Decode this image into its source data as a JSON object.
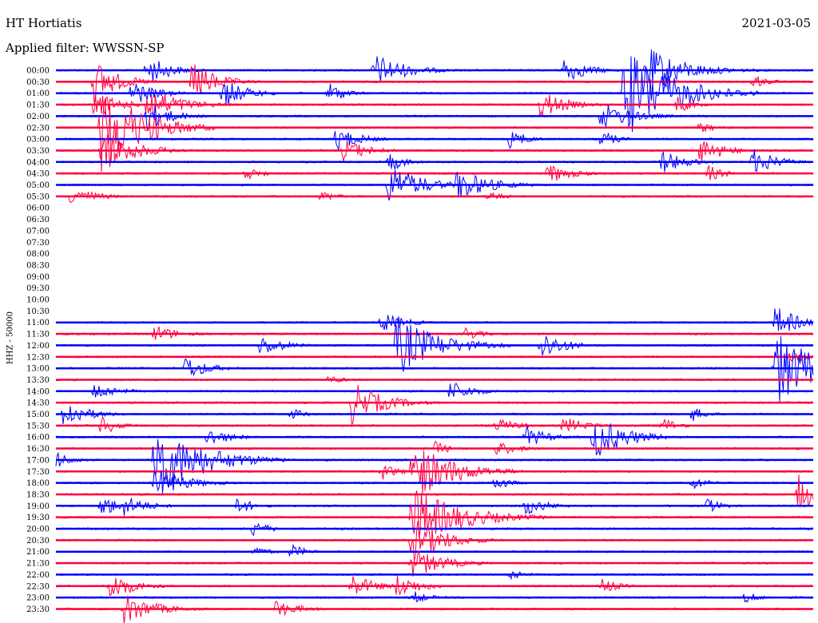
{
  "header": {
    "station": "HT Hortiatis",
    "date": "2021-03-05",
    "filter_label": "Applied filter:",
    "filter_value": "WWSSN-SP"
  },
  "colors": {
    "blue": "#0000ff",
    "red": "#ff0040"
  },
  "chart_data": {
    "type": "line",
    "title": "HT Hortiatis",
    "ylabel": "HHZ - 50000",
    "series_colors": [
      "blue",
      "red"
    ],
    "rows": [
      {
        "label": "00:00",
        "color": "blue",
        "events": [
          {
            "x": 0.12,
            "a": 20,
            "d": 0.03
          },
          {
            "x": 0.42,
            "a": 22,
            "d": 0.04
          },
          {
            "x": 0.67,
            "a": 18,
            "d": 0.03
          },
          {
            "x": 0.78,
            "a": 30,
            "d": 0.05
          }
        ]
      },
      {
        "label": "00:30",
        "color": "red",
        "events": [
          {
            "x": 0.05,
            "a": 30,
            "d": 0.03
          },
          {
            "x": 0.18,
            "a": 28,
            "d": 0.03
          },
          {
            "x": 0.92,
            "a": 10,
            "d": 0.02
          }
        ]
      },
      {
        "label": "01:00",
        "color": "blue",
        "events": [
          {
            "x": 0.1,
            "a": 18,
            "d": 0.03
          },
          {
            "x": 0.22,
            "a": 20,
            "d": 0.03
          },
          {
            "x": 0.36,
            "a": 16,
            "d": 0.02
          },
          {
            "x": 0.75,
            "a": 60,
            "d": 0.06
          }
        ]
      },
      {
        "label": "01:30",
        "color": "red",
        "events": [
          {
            "x": 0.05,
            "a": 20,
            "d": 0.03
          },
          {
            "x": 0.12,
            "a": 25,
            "d": 0.04
          },
          {
            "x": 0.64,
            "a": 20,
            "d": 0.03
          },
          {
            "x": 0.82,
            "a": 12,
            "d": 0.02
          }
        ]
      },
      {
        "label": "02:00",
        "color": "blue",
        "events": [
          {
            "x": 0.12,
            "a": 20,
            "d": 0.03
          },
          {
            "x": 0.72,
            "a": 18,
            "d": 0.04
          }
        ]
      },
      {
        "label": "02:30",
        "color": "red",
        "events": [
          {
            "x": 0.06,
            "a": 60,
            "d": 0.05
          },
          {
            "x": 0.85,
            "a": 8,
            "d": 0.02
          }
        ]
      },
      {
        "label": "03:00",
        "color": "blue",
        "events": [
          {
            "x": 0.37,
            "a": 16,
            "d": 0.03
          },
          {
            "x": 0.6,
            "a": 14,
            "d": 0.02
          },
          {
            "x": 0.72,
            "a": 12,
            "d": 0.02
          }
        ]
      },
      {
        "label": "03:30",
        "color": "red",
        "events": [
          {
            "x": 0.06,
            "a": 30,
            "d": 0.04
          },
          {
            "x": 0.38,
            "a": 16,
            "d": 0.03
          },
          {
            "x": 0.85,
            "a": 18,
            "d": 0.03
          }
        ]
      },
      {
        "label": "04:00",
        "color": "blue",
        "events": [
          {
            "x": 0.44,
            "a": 14,
            "d": 0.02
          },
          {
            "x": 0.8,
            "a": 16,
            "d": 0.03
          },
          {
            "x": 0.92,
            "a": 18,
            "d": 0.03
          }
        ]
      },
      {
        "label": "04:30",
        "color": "red",
        "events": [
          {
            "x": 0.25,
            "a": 10,
            "d": 0.02
          },
          {
            "x": 0.65,
            "a": 14,
            "d": 0.03
          },
          {
            "x": 0.86,
            "a": 12,
            "d": 0.02
          }
        ]
      },
      {
        "label": "05:00",
        "color": "blue",
        "events": [
          {
            "x": 0.44,
            "a": 28,
            "d": 0.04
          },
          {
            "x": 0.53,
            "a": 22,
            "d": 0.04
          }
        ]
      },
      {
        "label": "05:30",
        "color": "red",
        "events": [
          {
            "x": 0.02,
            "a": 14,
            "d": 0.03
          },
          {
            "x": 0.35,
            "a": 8,
            "d": 0.02
          },
          {
            "x": 0.57,
            "a": 8,
            "d": 0.02
          }
        ]
      },
      {
        "label": "06:00",
        "color": "blue",
        "events": []
      },
      {
        "label": "06:30",
        "color": "red",
        "events": []
      },
      {
        "label": "07:00",
        "color": "blue",
        "events": []
      },
      {
        "label": "07:30",
        "color": "red",
        "events": []
      },
      {
        "label": "08:00",
        "color": "blue",
        "events": []
      },
      {
        "label": "08:30",
        "color": "red",
        "events": []
      },
      {
        "label": "09:00",
        "color": "blue",
        "events": []
      },
      {
        "label": "09:30",
        "color": "red",
        "events": []
      },
      {
        "label": "10:00",
        "color": "blue",
        "events": []
      },
      {
        "label": "10:30",
        "color": "red",
        "events": []
      },
      {
        "label": "11:00",
        "color": "blue",
        "events": [
          {
            "x": 0.43,
            "a": 14,
            "d": 0.03
          },
          {
            "x": 0.95,
            "a": 22,
            "d": 0.03
          }
        ]
      },
      {
        "label": "11:30",
        "color": "red",
        "events": [
          {
            "x": 0.13,
            "a": 12,
            "d": 0.03
          },
          {
            "x": 0.54,
            "a": 10,
            "d": 0.02
          }
        ]
      },
      {
        "label": "12:00",
        "color": "blue",
        "events": [
          {
            "x": 0.27,
            "a": 14,
            "d": 0.03
          },
          {
            "x": 0.45,
            "a": 40,
            "d": 0.05
          },
          {
            "x": 0.64,
            "a": 20,
            "d": 0.03
          }
        ]
      },
      {
        "label": "12:30",
        "color": "red",
        "events": [
          {
            "x": 0.97,
            "a": 10,
            "d": 0.02
          }
        ]
      },
      {
        "label": "13:00",
        "color": "blue",
        "events": [
          {
            "x": 0.17,
            "a": 16,
            "d": 0.03
          },
          {
            "x": 0.95,
            "a": 50,
            "d": 0.05
          }
        ]
      },
      {
        "label": "13:30",
        "color": "red",
        "events": [
          {
            "x": 0.36,
            "a": 6,
            "d": 0.02
          }
        ]
      },
      {
        "label": "14:00",
        "color": "blue",
        "events": [
          {
            "x": 0.05,
            "a": 12,
            "d": 0.03
          },
          {
            "x": 0.52,
            "a": 14,
            "d": 0.03
          }
        ]
      },
      {
        "label": "14:30",
        "color": "red",
        "events": [
          {
            "x": 0.39,
            "a": 28,
            "d": 0.04
          }
        ]
      },
      {
        "label": "15:00",
        "color": "blue",
        "events": [
          {
            "x": 0.01,
            "a": 20,
            "d": 0.03
          },
          {
            "x": 0.31,
            "a": 8,
            "d": 0.02
          },
          {
            "x": 0.84,
            "a": 10,
            "d": 0.02
          }
        ]
      },
      {
        "label": "15:30",
        "color": "red",
        "events": [
          {
            "x": 0.06,
            "a": 14,
            "d": 0.02
          },
          {
            "x": 0.58,
            "a": 10,
            "d": 0.03
          },
          {
            "x": 0.67,
            "a": 12,
            "d": 0.03
          },
          {
            "x": 0.8,
            "a": 12,
            "d": 0.02
          }
        ]
      },
      {
        "label": "16:00",
        "color": "blue",
        "events": [
          {
            "x": 0.2,
            "a": 12,
            "d": 0.03
          },
          {
            "x": 0.62,
            "a": 14,
            "d": 0.03
          },
          {
            "x": 0.71,
            "a": 30,
            "d": 0.04
          }
        ]
      },
      {
        "label": "16:30",
        "color": "red",
        "events": [
          {
            "x": 0.5,
            "a": 10,
            "d": 0.02
          },
          {
            "x": 0.58,
            "a": 10,
            "d": 0.03
          }
        ]
      },
      {
        "label": "17:00",
        "color": "blue",
        "events": [
          {
            "x": 0.0,
            "a": 12,
            "d": 0.02
          },
          {
            "x": 0.13,
            "a": 50,
            "d": 0.06
          }
        ]
      },
      {
        "label": "17:30",
        "color": "red",
        "events": [
          {
            "x": 0.43,
            "a": 12,
            "d": 0.02
          },
          {
            "x": 0.47,
            "a": 40,
            "d": 0.05
          }
        ]
      },
      {
        "label": "18:00",
        "color": "blue",
        "events": [
          {
            "x": 0.13,
            "a": 20,
            "d": 0.04
          },
          {
            "x": 0.58,
            "a": 10,
            "d": 0.02
          },
          {
            "x": 0.84,
            "a": 10,
            "d": 0.02
          }
        ]
      },
      {
        "label": "18:30",
        "color": "red",
        "events": [
          {
            "x": 0.98,
            "a": 30,
            "d": 0.02
          }
        ]
      },
      {
        "label": "19:00",
        "color": "blue",
        "events": [
          {
            "x": 0.06,
            "a": 14,
            "d": 0.03
          },
          {
            "x": 0.09,
            "a": 14,
            "d": 0.03
          },
          {
            "x": 0.24,
            "a": 12,
            "d": 0.02
          },
          {
            "x": 0.62,
            "a": 12,
            "d": 0.03
          },
          {
            "x": 0.86,
            "a": 10,
            "d": 0.02
          }
        ]
      },
      {
        "label": "19:30",
        "color": "red",
        "events": [
          {
            "x": 0.47,
            "a": 40,
            "d": 0.06
          }
        ]
      },
      {
        "label": "20:00",
        "color": "blue",
        "events": [
          {
            "x": 0.26,
            "a": 12,
            "d": 0.02
          }
        ]
      },
      {
        "label": "20:30",
        "color": "red",
        "events": [
          {
            "x": 0.47,
            "a": 30,
            "d": 0.04
          }
        ]
      },
      {
        "label": "21:00",
        "color": "blue",
        "events": [
          {
            "x": 0.26,
            "a": 8,
            "d": 0.02
          },
          {
            "x": 0.31,
            "a": 10,
            "d": 0.02
          }
        ]
      },
      {
        "label": "21:30",
        "color": "red",
        "events": [
          {
            "x": 0.47,
            "a": 20,
            "d": 0.04
          }
        ]
      },
      {
        "label": "22:00",
        "color": "blue",
        "events": [
          {
            "x": 0.6,
            "a": 8,
            "d": 0.02
          }
        ]
      },
      {
        "label": "22:30",
        "color": "red",
        "events": [
          {
            "x": 0.07,
            "a": 20,
            "d": 0.03
          },
          {
            "x": 0.39,
            "a": 16,
            "d": 0.03
          },
          {
            "x": 0.45,
            "a": 16,
            "d": 0.03
          },
          {
            "x": 0.72,
            "a": 12,
            "d": 0.02
          }
        ]
      },
      {
        "label": "23:00",
        "color": "blue",
        "events": [
          {
            "x": 0.47,
            "a": 10,
            "d": 0.02
          },
          {
            "x": 0.91,
            "a": 8,
            "d": 0.02
          }
        ]
      },
      {
        "label": "23:30",
        "color": "red",
        "events": [
          {
            "x": 0.09,
            "a": 20,
            "d": 0.04
          },
          {
            "x": 0.29,
            "a": 12,
            "d": 0.03
          }
        ]
      }
    ]
  }
}
